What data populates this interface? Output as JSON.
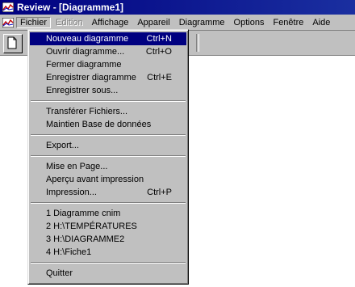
{
  "window": {
    "title": "Review - [Diagramme1]"
  },
  "menubar": {
    "items": [
      {
        "label": "Fichier",
        "state": "active"
      },
      {
        "label": "Edition",
        "state": "disabled"
      },
      {
        "label": "Affichage",
        "state": "normal"
      },
      {
        "label": "Appareil",
        "state": "normal"
      },
      {
        "label": "Diagramme",
        "state": "normal"
      },
      {
        "label": "Options",
        "state": "normal"
      },
      {
        "label": "Fenêtre",
        "state": "normal"
      },
      {
        "label": "Aide",
        "state": "normal"
      }
    ]
  },
  "file_menu": {
    "groups": [
      [
        {
          "label": "Nouveau diagramme",
          "shortcut": "Ctrl+N",
          "highlighted": true
        },
        {
          "label": "Ouvrir diagramme...",
          "shortcut": "Ctrl+O"
        },
        {
          "label": "Fermer diagramme",
          "shortcut": ""
        },
        {
          "label": "Enregistrer diagramme",
          "shortcut": "Ctrl+E"
        },
        {
          "label": "Enregistrer sous...",
          "shortcut": ""
        }
      ],
      [
        {
          "label": "Transférer Fichiers...",
          "shortcut": ""
        },
        {
          "label": "Maintien Base de données",
          "shortcut": ""
        }
      ],
      [
        {
          "label": "Export...",
          "shortcut": ""
        }
      ],
      [
        {
          "label": "Mise en Page...",
          "shortcut": ""
        },
        {
          "label": "Aperçu avant impression",
          "shortcut": ""
        },
        {
          "label": "Impression...",
          "shortcut": "Ctrl+P"
        }
      ],
      [
        {
          "label": "1 Diagramme cnim",
          "shortcut": ""
        },
        {
          "label": "2 H:\\TEMPÉRATURES",
          "shortcut": ""
        },
        {
          "label": "3 H:\\DIAGRAMME2",
          "shortcut": ""
        },
        {
          "label": "4 H:\\Fiche1",
          "shortcut": ""
        }
      ],
      [
        {
          "label": "Quitter",
          "shortcut": ""
        }
      ]
    ]
  },
  "colors": {
    "titlebar": "#000080",
    "face": "#c0c0c0",
    "highlight": "#000080"
  },
  "icons": {
    "app": "review-app-icon",
    "doc": "document-icon",
    "toolbar_first": "new-document-icon"
  }
}
